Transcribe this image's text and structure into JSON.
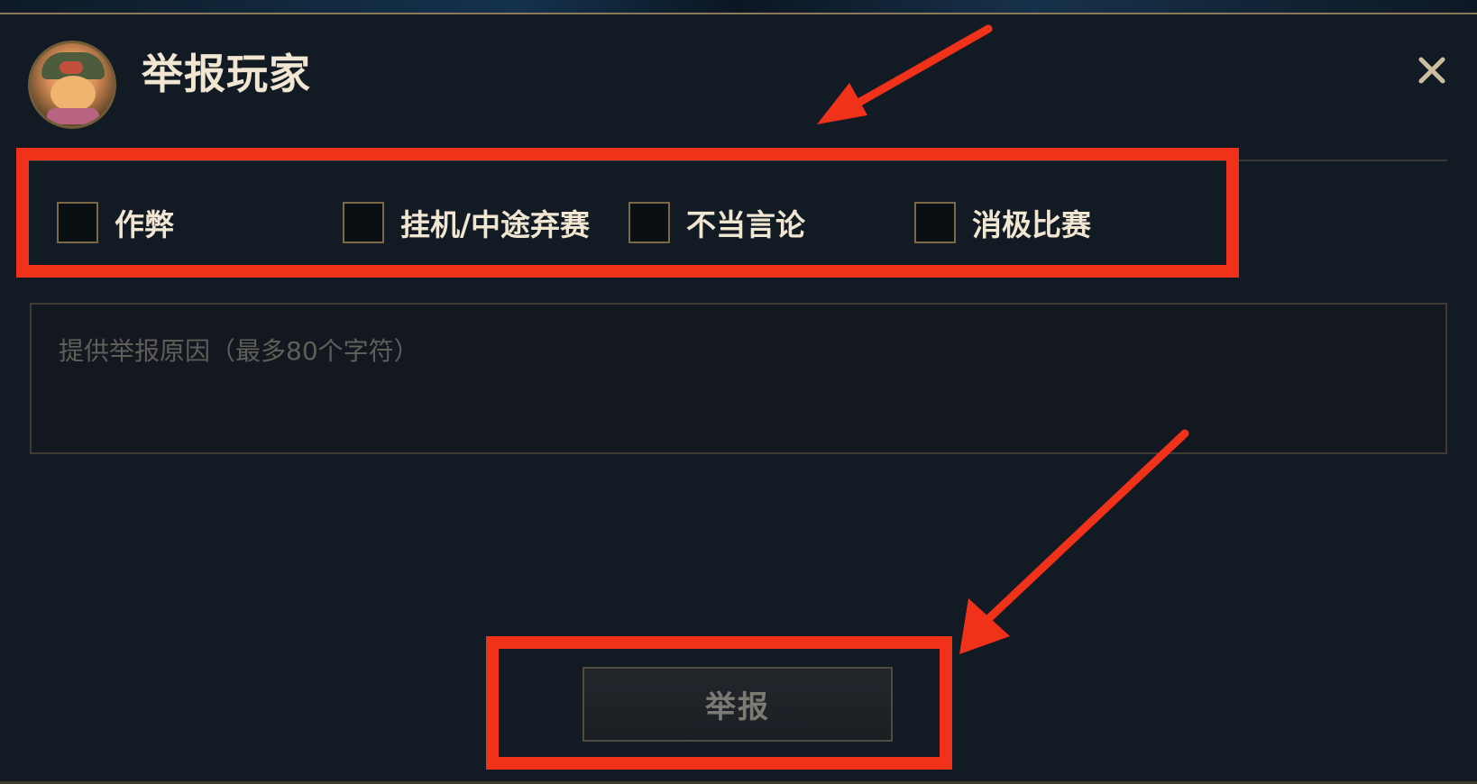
{
  "dialog": {
    "title": "举报玩家",
    "close_icon": "close-icon",
    "avatar_icon": "champion-avatar"
  },
  "report_options": [
    {
      "label": "作弊",
      "checked": false
    },
    {
      "label": "挂机/中途弃赛",
      "checked": false
    },
    {
      "label": "不当言论",
      "checked": false
    },
    {
      "label": "消极比赛",
      "checked": false
    }
  ],
  "reason_input": {
    "placeholder": "提供举报原因（最多80个字符）",
    "value": ""
  },
  "submit": {
    "label": "举报"
  },
  "colors": {
    "background": "#121a23",
    "title_text": "#f0e6d2",
    "border_gold": "#7a6a48",
    "annotation_red": "#f1321b",
    "button_text": "#7c7a73"
  }
}
